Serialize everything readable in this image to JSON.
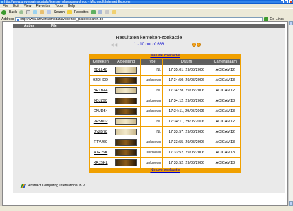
{
  "browser": {
    "window_title": "http://www.universalmsdatalv/license_plates/search.do - Microsoft Internet Explorer",
    "menu": [
      "File",
      "Edit",
      "View",
      "Favorites",
      "Tools",
      "Help"
    ],
    "toolbar": {
      "back_label": "Back",
      "search_label": "Search",
      "favorites_label": "Favorites"
    },
    "address_label": "Address",
    "address_value": "http://www.universalmsdatalv/license_plates/search.do",
    "go_label": "Go",
    "links_label": "Links"
  },
  "app": {
    "nav": [
      "Acties",
      "File"
    ],
    "page_title": "Resultaten kenteken-zoekactie",
    "pager": {
      "text": "1 - 10 out of 666",
      "prev_symbol": "◀◀"
    },
    "new_search_label": "Nieuwe zoekactie",
    "columns": [
      "Kenteken",
      "Afbeelding",
      "Type",
      "Datum",
      "Cameranaam"
    ],
    "rows": [
      {
        "plate": "TDLL48",
        "type": "NL",
        "date": "17:35:01, 29/05/2006",
        "camera": "ACICAM12",
        "thumb": "light"
      },
      {
        "plate": "92DHDD",
        "type": "unknown",
        "date": "17:34:50, 29/05/2006",
        "camera": "ACICAM13",
        "thumb": "dark"
      },
      {
        "plate": "BRTB44",
        "type": "NL",
        "date": "17:34:28, 29/05/2006",
        "camera": "ACICAM12",
        "thumb": "light"
      },
      {
        "plate": "XBJZ90",
        "type": "unknown",
        "date": "17:34:12, 29/05/2006",
        "camera": "ACICAM13",
        "thumb": "dark"
      },
      {
        "plate": "GNJD54",
        "type": "unknown",
        "date": "17:34:11, 29/05/2006",
        "camera": "ACICAM13",
        "thumb": "dark"
      },
      {
        "plate": "VPSB02",
        "type": "NL",
        "date": "17:34:11, 29/05/2006",
        "camera": "ACICAM12",
        "thumb": "light"
      },
      {
        "plate": "JNZB78",
        "type": "NL",
        "date": "17:33:57, 29/05/2006",
        "camera": "ACICAM12",
        "thumb": "light"
      },
      {
        "plate": "RTVJ69",
        "type": "unknown",
        "date": "17:33:55, 29/05/2006",
        "camera": "ACICAM13",
        "thumb": "dark"
      },
      {
        "plate": "40RJSK",
        "type": "unknown",
        "date": "17:33:52, 29/05/2006",
        "camera": "ACICAM13",
        "thumb": "dark"
      },
      {
        "plate": "XRJSKL",
        "type": "unknown",
        "date": "17:33:52, 29/05/2006",
        "camera": "ACICAM13",
        "thumb": "dark"
      }
    ],
    "footer": "Abstract Computing International B.V."
  },
  "colors": {
    "accent": "#f0a000",
    "header": "#5f5f5f",
    "nav": "#666666",
    "link": "#0000cc"
  }
}
